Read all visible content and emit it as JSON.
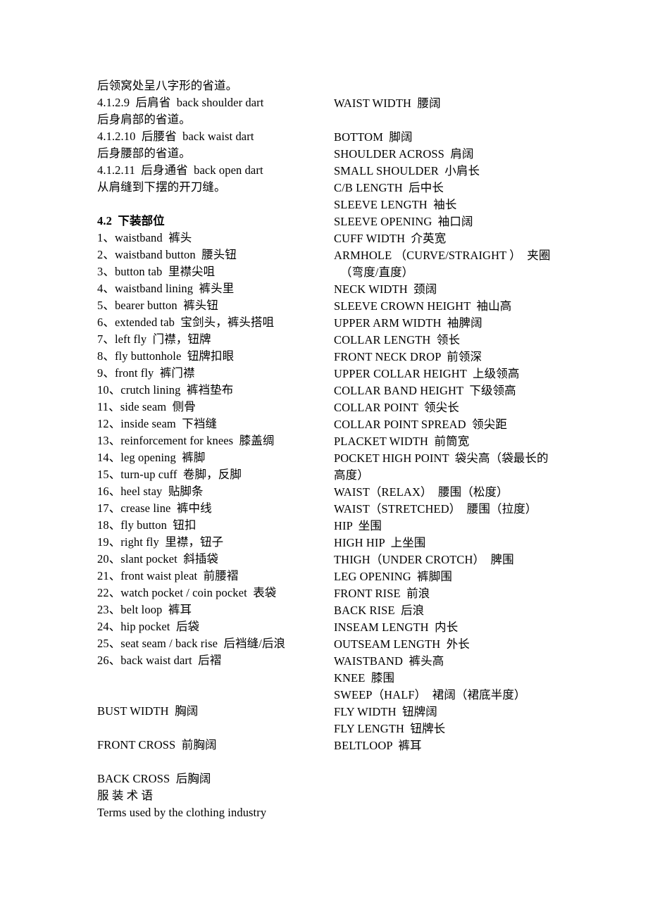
{
  "document": {
    "columns": {
      "left": {
        "name": "left-text-column",
        "lines": [
          {
            "text": "后领窝处呈八字形的省道。",
            "style": "normal"
          },
          {
            "text": "4.1.2.9  后肩省  back shoulder dart",
            "style": "normal"
          },
          {
            "text": "后身肩部的省道。",
            "style": "normal"
          },
          {
            "text": "4.1.2.10  后腰省  back waist dart",
            "style": "normal"
          },
          {
            "text": "后身腰部的省道。",
            "style": "normal"
          },
          {
            "text": "4.1.2.11  后身通省  back open dart",
            "style": "normal"
          },
          {
            "text": "从肩缝到下摆的开刀缝。",
            "style": "normal"
          },
          {
            "text": "",
            "style": "blank"
          },
          {
            "text": "4.2  下装部位",
            "style": "bold"
          },
          {
            "text": "1、waistband  裤头",
            "style": "normal"
          },
          {
            "text": "2、waistband button  腰头钮",
            "style": "normal"
          },
          {
            "text": "3、button tab  里襟尖咀",
            "style": "normal"
          },
          {
            "text": "4、waistband lining  裤头里",
            "style": "normal"
          },
          {
            "text": "5、bearer button  裤头钮",
            "style": "normal"
          },
          {
            "text": "6、extended tab  宝剑头，裤头搭咀",
            "style": "normal"
          },
          {
            "text": "7、left fly  门襟，钮牌",
            "style": "normal"
          },
          {
            "text": "8、fly buttonhole  钮牌扣眼",
            "style": "normal"
          },
          {
            "text": "9、front fly  裤门襟",
            "style": "normal"
          },
          {
            "text": "10、crutch lining  裤裆垫布",
            "style": "normal"
          },
          {
            "text": "11、side seam  侧骨",
            "style": "normal"
          },
          {
            "text": "12、inside seam  下裆缝",
            "style": "normal"
          },
          {
            "text": "13、reinforcement for knees  膝盖绸",
            "style": "normal"
          },
          {
            "text": "14、leg opening  裤脚",
            "style": "normal"
          },
          {
            "text": "15、turn-up cuff  卷脚，反脚",
            "style": "normal"
          },
          {
            "text": "16、heel stay  贴脚条",
            "style": "normal"
          },
          {
            "text": "17、crease line  裤中线",
            "style": "normal"
          },
          {
            "text": "18、fly button  钮扣",
            "style": "normal"
          },
          {
            "text": "19、right fly  里襟，钮子",
            "style": "normal"
          },
          {
            "text": "20、slant pocket  斜插袋",
            "style": "normal"
          },
          {
            "text": "21、front waist pleat  前腰褶",
            "style": "normal"
          },
          {
            "text": "22、watch pocket / coin pocket  表袋",
            "style": "normal"
          },
          {
            "text": "23、belt loop  裤耳",
            "style": "normal"
          },
          {
            "text": "24、hip pocket  后袋",
            "style": "normal"
          },
          {
            "text": "25、seat seam / back rise  后裆缝/后浪",
            "style": "normal"
          },
          {
            "text": "26、back waist dart  后褶",
            "style": "normal"
          },
          {
            "text": "",
            "style": "blank"
          },
          {
            "text": "",
            "style": "blank"
          },
          {
            "text": "BUST WIDTH  胸阔",
            "style": "normal"
          },
          {
            "text": "",
            "style": "blank"
          },
          {
            "text": "FRONT CROSS  前胸阔",
            "style": "normal"
          },
          {
            "text": "",
            "style": "blank"
          },
          {
            "text": "BACK CROSS  后胸阔",
            "style": "normal"
          },
          {
            "text": "服 装 术 语",
            "style": "normal"
          },
          {
            "text": "Terms used by the clothing industry",
            "style": "normal"
          }
        ]
      },
      "right": {
        "name": "right-text-column",
        "lines": [
          {
            "text": "WAIST WIDTH  腰阔",
            "style": "normal"
          },
          {
            "text": "",
            "style": "blank"
          },
          {
            "text": "BOTTOM  脚阔",
            "style": "normal"
          },
          {
            "text": "SHOULDER ACROSS  肩阔",
            "style": "normal"
          },
          {
            "text": "SMALL SHOULDER  小肩长",
            "style": "normal"
          },
          {
            "text": "C/B LENGTH  后中长",
            "style": "normal"
          },
          {
            "text": "SLEEVE LENGTH  袖长",
            "style": "normal"
          },
          {
            "text": "SLEEVE OPENING  袖口阔",
            "style": "normal"
          },
          {
            "text": "CUFF WIDTH  介英宽",
            "style": "normal"
          },
          {
            "text": "ARMHOLE （CURVE/STRAIGHT ）  夹圈",
            "style": "normal"
          },
          {
            "text": "（弯度/直度）",
            "style": "indent"
          },
          {
            "text": "NECK WIDTH  颈阔",
            "style": "normal"
          },
          {
            "text": "SLEEVE CROWN HEIGHT  袖山高",
            "style": "normal"
          },
          {
            "text": "UPPER ARM WIDTH  袖脾阔",
            "style": "normal"
          },
          {
            "text": "COLLAR LENGTH  领长",
            "style": "normal"
          },
          {
            "text": "FRONT NECK DROP  前领深",
            "style": "normal"
          },
          {
            "text": "UPPER COLLAR HEIGHT  上级领高",
            "style": "normal"
          },
          {
            "text": "COLLAR BAND HEIGHT  下级领高",
            "style": "normal"
          },
          {
            "text": "COLLAR POINT  领尖长",
            "style": "normal"
          },
          {
            "text": "COLLAR POINT SPREAD  领尖距",
            "style": "normal"
          },
          {
            "text": "PLACKET WIDTH  前筒宽",
            "style": "normal"
          },
          {
            "text": "POCKET HIGH POINT  袋尖高（袋最长的",
            "style": "normal"
          },
          {
            "text": "高度）",
            "style": "normal"
          },
          {
            "text": "WAIST（RELAX）  腰围（松度）",
            "style": "normal"
          },
          {
            "text": "WAIST（STRETCHED）  腰围（拉度）",
            "style": "normal"
          },
          {
            "text": "HIP  坐围",
            "style": "normal"
          },
          {
            "text": "HIGH HIP  上坐围",
            "style": "normal"
          },
          {
            "text": "THIGH（UNDER CROTCH）  脾围",
            "style": "normal"
          },
          {
            "text": "LEG OPENING  裤脚围",
            "style": "normal"
          },
          {
            "text": "FRONT RISE  前浪",
            "style": "normal"
          },
          {
            "text": "BACK RISE  后浪",
            "style": "normal"
          },
          {
            "text": "INSEAM LENGTH  内长",
            "style": "normal"
          },
          {
            "text": "OUTSEAM LENGTH  外长",
            "style": "normal"
          },
          {
            "text": "WAISTBAND  裤头高",
            "style": "normal"
          },
          {
            "text": "KNEE  膝围",
            "style": "normal"
          },
          {
            "text": "SWEEP（HALF）  裙阔（裙底半度）",
            "style": "normal"
          },
          {
            "text": "FLY WIDTH  钮牌阔",
            "style": "normal"
          },
          {
            "text": "FLY LENGTH  钮牌长",
            "style": "normal"
          },
          {
            "text": "BELTLOOP  裤耳",
            "style": "normal"
          }
        ]
      }
    }
  }
}
